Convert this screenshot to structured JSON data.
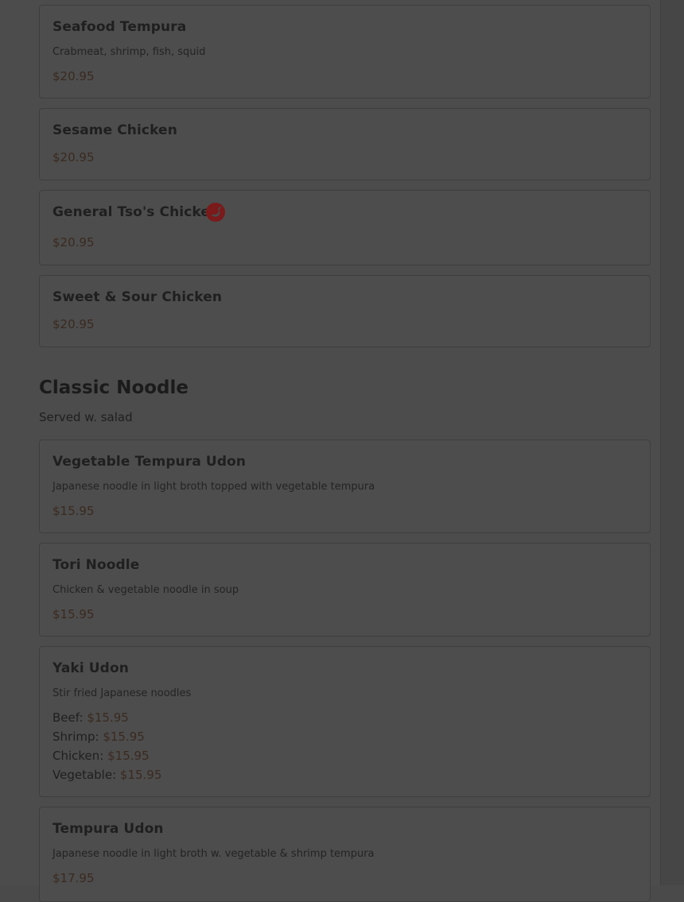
{
  "menu": {
    "items_top": [
      {
        "name": "Seafood Tempura",
        "description": "Crabmeat, shrimp, fish, squid",
        "price": "$20.95"
      },
      {
        "name": "Sesame Chicken",
        "price": "$20.95"
      },
      {
        "name": "General Tso's Chicken",
        "price": "$20.95",
        "spicy": true,
        "icon": "chili-pepper-icon"
      },
      {
        "name": "Sweet & Sour Chicken",
        "price": "$20.95"
      }
    ],
    "section": {
      "title": "Classic Noodle",
      "subtitle": "Served w. salad"
    },
    "items_noodle": [
      {
        "name": "Vegetable Tempura Udon",
        "description": "Japanese noodle in light broth topped with vegetable tempura",
        "price": "$15.95"
      },
      {
        "name": "Tori Noodle",
        "description": "Chicken & vegetable noodle in soup",
        "price": "$15.95"
      },
      {
        "name": "Yaki Udon",
        "description": "Stir fried Japanese noodles",
        "options": [
          {
            "label": "Beef:",
            "price": "$15.95"
          },
          {
            "label": "Shrimp:",
            "price": "$15.95"
          },
          {
            "label": "Chicken:",
            "price": "$15.95"
          },
          {
            "label": "Vegetable:",
            "price": "$15.95"
          }
        ]
      },
      {
        "name": "Tempura Udon",
        "description": "Japanese noodle in light broth w. vegetable & shrimp tempura",
        "price": "$17.95"
      }
    ]
  },
  "colors": {
    "overlay_background": "#4a4a4a",
    "price_color": "#3a2a20",
    "spicy_icon_color": "#7a1a1a"
  }
}
